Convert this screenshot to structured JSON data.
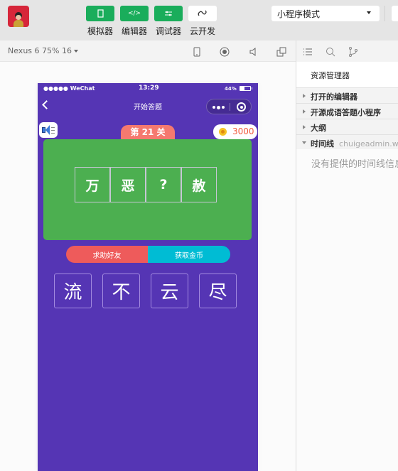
{
  "toolbar": {
    "tools": [
      {
        "label": "模拟器",
        "icon": "phone-icon"
      },
      {
        "label": "编辑器",
        "icon": "code-icon"
      },
      {
        "label": "调试器",
        "icon": "debug-icon"
      },
      {
        "label": "云开发",
        "icon": "cloud-link-icon"
      }
    ],
    "mode_select": "小程序模式"
  },
  "simulator_bar": {
    "device": "Nexus 6 75% 16"
  },
  "phone": {
    "status": {
      "carrier": "●●●●● WeChat",
      "time": "13:29",
      "battery": "44%"
    },
    "nav_title": "开始答题",
    "level": "第 21 关",
    "coins": "3000",
    "puzzle": [
      "万",
      "恶",
      "?",
      "赦"
    ],
    "buttons": {
      "help": "求助好友",
      "get_coins": "获取金币"
    },
    "choices": [
      "流",
      "不",
      "云",
      "尽"
    ],
    "colors": {
      "background": "#5535b4",
      "board": "#4caf50",
      "level": "#f5796f",
      "help": "#ee5b5b",
      "gold": "#00bcd4"
    }
  },
  "explorer": {
    "title": "资源管理器",
    "sections": [
      {
        "label": "打开的编辑器",
        "open": false
      },
      {
        "label": "开源成语答题小程序",
        "open": false
      },
      {
        "label": "大纲",
        "open": false
      },
      {
        "label": "时间线",
        "sub": "chuigeadmin.w",
        "open": true
      }
    ],
    "timeline_empty": "没有提供的时间线信息"
  }
}
